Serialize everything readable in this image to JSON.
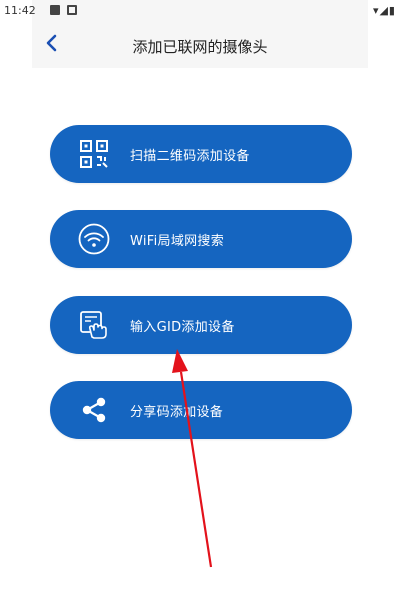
{
  "status_bar": {
    "time": "11:42",
    "right_icons": "▾◢▮"
  },
  "header": {
    "title": "添加已联网的摄像头"
  },
  "buttons": [
    {
      "label": "扫描二维码添加设备",
      "icon": "qr-code-icon"
    },
    {
      "label": "WiFi局域网搜索",
      "icon": "wifi-icon"
    },
    {
      "label": "输入GID添加设备",
      "icon": "tap-screen-icon"
    },
    {
      "label": "分享码添加设备",
      "icon": "share-icon"
    }
  ],
  "colors": {
    "button_bg": "#1565c0",
    "header_bg": "#f6f6f6",
    "arrow": "#e3121b",
    "back": "#1a4fb3"
  }
}
